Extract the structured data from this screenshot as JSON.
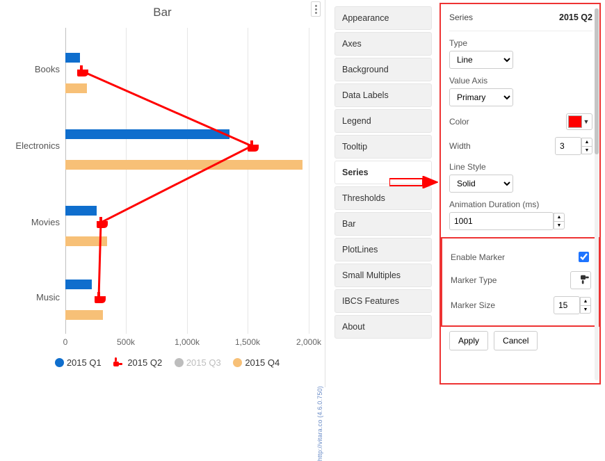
{
  "chart": {
    "title": "Bar",
    "watermark": "http://vitara.co  (4.6.0.750)",
    "legend": {
      "q1": "2015 Q1",
      "q2": "2015 Q2",
      "q3": "2015 Q3",
      "q4": "2015 Q4"
    },
    "xaxis": {
      "ticks": [
        "0",
        "500k",
        "1,000k",
        "1,500k",
        "2,000k"
      ]
    }
  },
  "chart_data": {
    "type": "bar",
    "orientation": "horizontal",
    "categories": [
      "Books",
      "Electronics",
      "Movies",
      "Music"
    ],
    "series": [
      {
        "name": "2015 Q1",
        "color": "#0f6ecd",
        "values": [
          120000,
          1350000,
          260000,
          220000
        ]
      },
      {
        "name": "2015 Q2",
        "color": "#ff0000",
        "type": "line",
        "marker": "hand-icon",
        "values": [
          130000,
          1530000,
          290000,
          275000
        ]
      },
      {
        "name": "2015 Q3",
        "color": "#bdbdbd",
        "values": [
          null,
          null,
          null,
          null
        ],
        "hidden": true
      },
      {
        "name": "2015 Q4",
        "color": "#f7c077",
        "values": [
          180000,
          1950000,
          340000,
          310000
        ]
      }
    ],
    "xlabel": "",
    "ylabel": "",
    "xlim": [
      0,
      2000000
    ],
    "grid": true,
    "legend_position": "bottom"
  },
  "menu": {
    "items": [
      "Appearance",
      "Axes",
      "Background",
      "Data Labels",
      "Legend",
      "Tooltip",
      "Series",
      "Thresholds",
      "Bar",
      "PlotLines",
      "Small Multiples",
      "IBCS Features",
      "About"
    ],
    "active": "Series"
  },
  "props": {
    "header_label": "Series",
    "header_value": "2015 Q2",
    "type_label": "Type",
    "type_value": "Line",
    "value_axis_label": "Value Axis",
    "value_axis_value": "Primary",
    "color_label": "Color",
    "color_value": "#ff0000",
    "width_label": "Width",
    "width_value": "3",
    "line_style_label": "Line Style",
    "line_style_value": "Solid",
    "anim_label": "Animation Duration (ms)",
    "anim_value": "1001",
    "enable_marker_label": "Enable Marker",
    "enable_marker_value": true,
    "marker_type_label": "Marker Type",
    "marker_size_label": "Marker Size",
    "marker_size_value": "15",
    "apply": "Apply",
    "cancel": "Cancel"
  }
}
